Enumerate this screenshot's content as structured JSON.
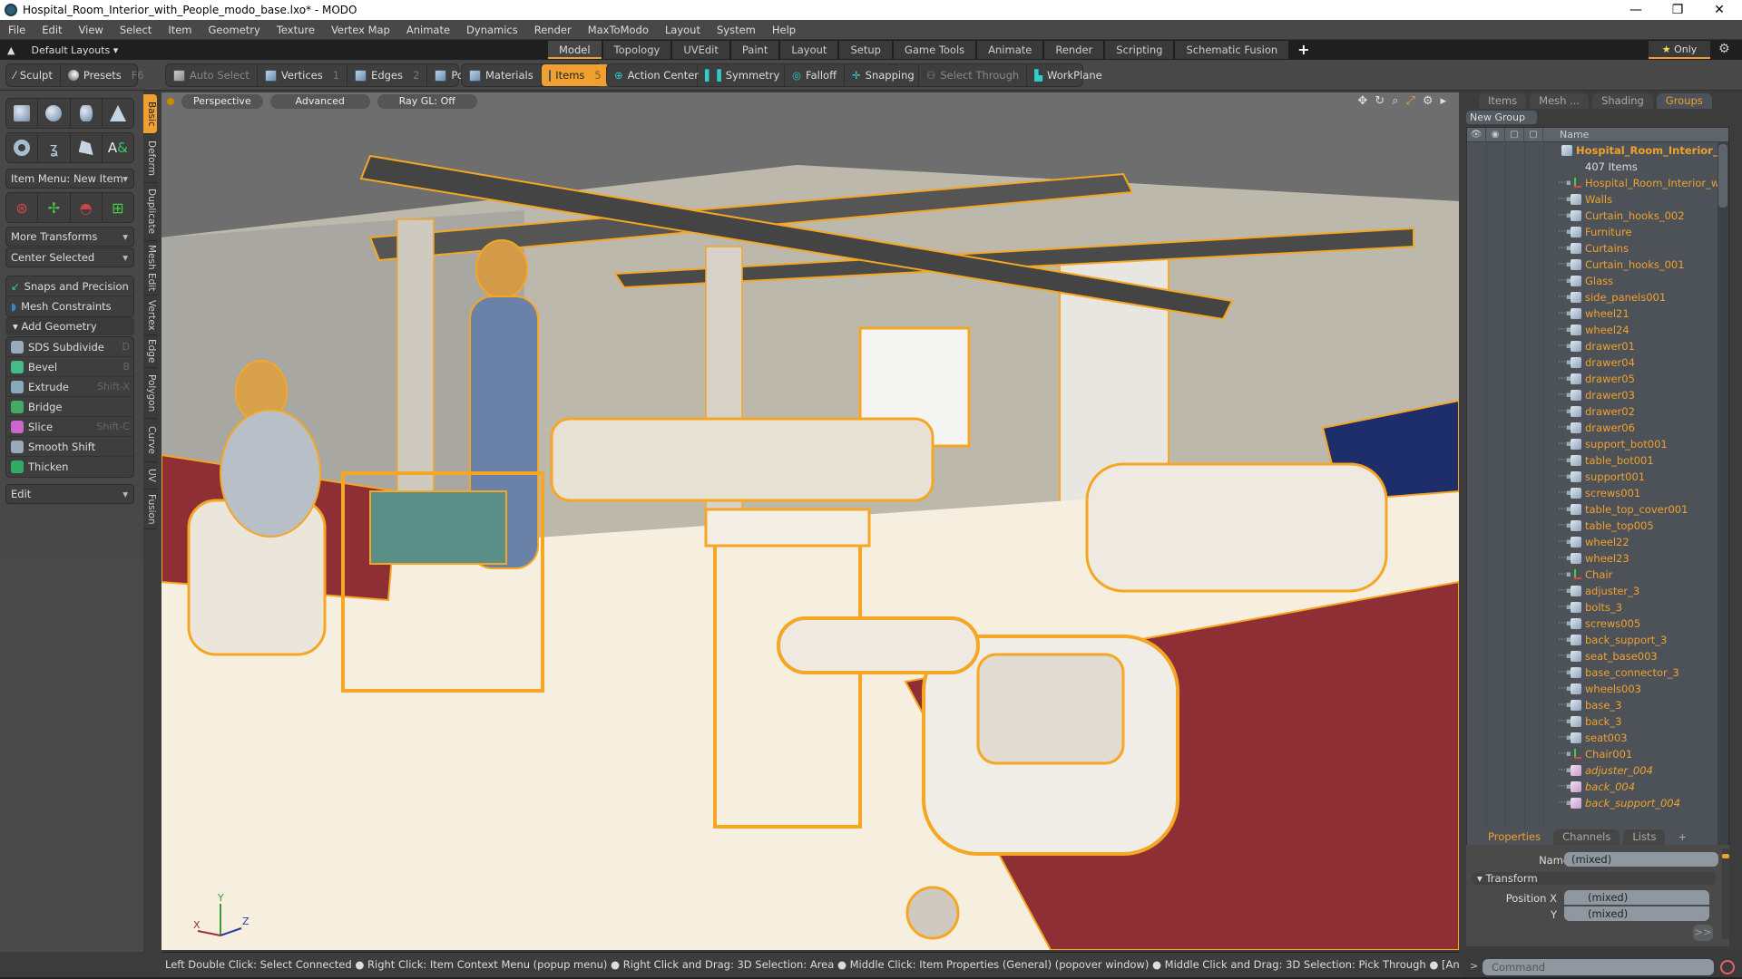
{
  "window": {
    "title": "Hospital_Room_Interior_with_People_modo_base.lxo* - MODO",
    "controls": {
      "minimize": "—",
      "maximize": "❐",
      "close": "✕"
    }
  },
  "menu": [
    "File",
    "Edit",
    "View",
    "Select",
    "Item",
    "Geometry",
    "Texture",
    "Vertex Map",
    "Animate",
    "Dynamics",
    "Render",
    "MaxToModo",
    "Layout",
    "System",
    "Help"
  ],
  "layout_bar": {
    "default_layouts": "Default Layouts ▾",
    "tabs": [
      "Model",
      "Topology",
      "UVEdit",
      "Paint",
      "Layout",
      "Setup",
      "Game Tools",
      "Animate",
      "Render",
      "Scripting",
      "Schematic Fusion"
    ],
    "active_tab": "Model",
    "add_tab": "+",
    "only_label": "Only",
    "only_star": "★"
  },
  "toolbar": {
    "sculpt": "Sculpt",
    "presets": "Presets",
    "presets_key": "F6",
    "auto_select": "Auto Select",
    "vertices": "Vertices",
    "vertices_key": "1",
    "edges": "Edges",
    "edges_key": "2",
    "polygons": "Polygons",
    "materials": "Materials",
    "items": "Items",
    "items_key": "5",
    "action_center": "Action Center",
    "symmetry": "Symmetry",
    "falloff": "Falloff",
    "snapping": "Snapping",
    "select_through": "Select Through",
    "workplane": "WorkPlane"
  },
  "left_panel": {
    "item_menu": "Item Menu: New Item",
    "more_transforms": "More Transforms",
    "center_selected": "Center Selected",
    "snaps": "Snaps and Precision",
    "mesh_constraints": "Mesh Constraints",
    "add_geometry": "Add Geometry",
    "tools": [
      {
        "label": "SDS Subdivide",
        "key": "D"
      },
      {
        "label": "Bevel",
        "key": "B"
      },
      {
        "label": "Extrude",
        "key": "Shift-X"
      },
      {
        "label": "Bridge",
        "key": ""
      },
      {
        "label": "Slice",
        "key": "Shift-C"
      },
      {
        "label": "Smooth Shift",
        "key": ""
      },
      {
        "label": "Thicken",
        "key": ""
      }
    ],
    "edit_dropdown": "Edit",
    "vertical_tabs": [
      "Basic",
      "Deform",
      "Duplicate",
      "Mesh Edit",
      "Vertex",
      "Edge",
      "Polygon",
      "Curve",
      "UV",
      "Fusion"
    ],
    "active_vertical_tab": "Basic"
  },
  "viewport": {
    "view_mode": "Perspective",
    "shading": "Advanced",
    "ray_gl": "Ray GL: Off",
    "axis": {
      "x": "X",
      "y": "Y",
      "z": "Z"
    },
    "colors": {
      "wire": "#f5a623",
      "floor": "#f6eedf",
      "mattress": "#8e2f36"
    }
  },
  "status_bar": "Left Double Click: Select Connected ● Right Click: Item Context Menu (popup menu) ● Right Click and Drag: 3D Selection: Area ● Middle Click: Item Properties (General) (popover window) ● Middle Click and Drag: 3D Selection: Pick Through ● [Any Key]-[Any Button] Click and Drag: dragDrop...",
  "right_panel": {
    "tabs": [
      "Items",
      "Mesh ...",
      "Shading",
      "Groups"
    ],
    "active_tab": "Groups",
    "new_group": "New Group",
    "name_header": "Name",
    "root": {
      "label": "Hospital_Room_Interior_ ...",
      "count": "407 Items"
    },
    "items": [
      {
        "label": "Hospital_Room_Interior_wit...",
        "type": "locator"
      },
      {
        "label": "Walls",
        "type": "mesh"
      },
      {
        "label": "Curtain_hooks_002",
        "type": "mesh"
      },
      {
        "label": "Furniture",
        "type": "mesh"
      },
      {
        "label": "Curtains",
        "type": "mesh"
      },
      {
        "label": "Curtain_hooks_001",
        "type": "mesh"
      },
      {
        "label": "Glass",
        "type": "mesh"
      },
      {
        "label": "side_panels001",
        "type": "mesh"
      },
      {
        "label": "wheel21",
        "type": "mesh"
      },
      {
        "label": "wheel24",
        "type": "mesh"
      },
      {
        "label": "drawer01",
        "type": "mesh"
      },
      {
        "label": "drawer04",
        "type": "mesh"
      },
      {
        "label": "drawer05",
        "type": "mesh"
      },
      {
        "label": "drawer03",
        "type": "mesh"
      },
      {
        "label": "drawer02",
        "type": "mesh"
      },
      {
        "label": "drawer06",
        "type": "mesh"
      },
      {
        "label": "support_bot001",
        "type": "mesh"
      },
      {
        "label": "table_bot001",
        "type": "mesh"
      },
      {
        "label": "support001",
        "type": "mesh"
      },
      {
        "label": "screws001",
        "type": "mesh"
      },
      {
        "label": "table_top_cover001",
        "type": "mesh"
      },
      {
        "label": "table_top005",
        "type": "mesh"
      },
      {
        "label": "wheel22",
        "type": "mesh"
      },
      {
        "label": "wheel23",
        "type": "mesh"
      },
      {
        "label": "Chair",
        "type": "locator"
      },
      {
        "label": "adjuster_3",
        "type": "mesh"
      },
      {
        "label": "bolts_3",
        "type": "mesh"
      },
      {
        "label": "screws005",
        "type": "mesh"
      },
      {
        "label": "back_support_3",
        "type": "mesh"
      },
      {
        "label": "seat_base003",
        "type": "mesh"
      },
      {
        "label": "base_connector_3",
        "type": "mesh"
      },
      {
        "label": "wheels003",
        "type": "mesh"
      },
      {
        "label": "base_3",
        "type": "mesh"
      },
      {
        "label": "back_3",
        "type": "mesh"
      },
      {
        "label": "seat003",
        "type": "mesh"
      },
      {
        "label": "Chair001",
        "type": "locator"
      },
      {
        "label": "adjuster_004",
        "type": "instance"
      },
      {
        "label": "back_004",
        "type": "instance"
      },
      {
        "label": "back_support_004",
        "type": "instance"
      }
    ],
    "props_tabs": [
      "Properties",
      "Channels",
      "Lists"
    ],
    "props_active": "Properties",
    "props_add": "+",
    "name_label": "Name",
    "name_value": "(mixed)",
    "transform_label": "Transform",
    "position_x_label": "Position X",
    "position_x_value": "(mixed)",
    "position_y_label": "Y",
    "position_y_value": "(mixed)",
    "more_button": ">>",
    "command_placeholder": "Command",
    "command_prompt": ">"
  }
}
